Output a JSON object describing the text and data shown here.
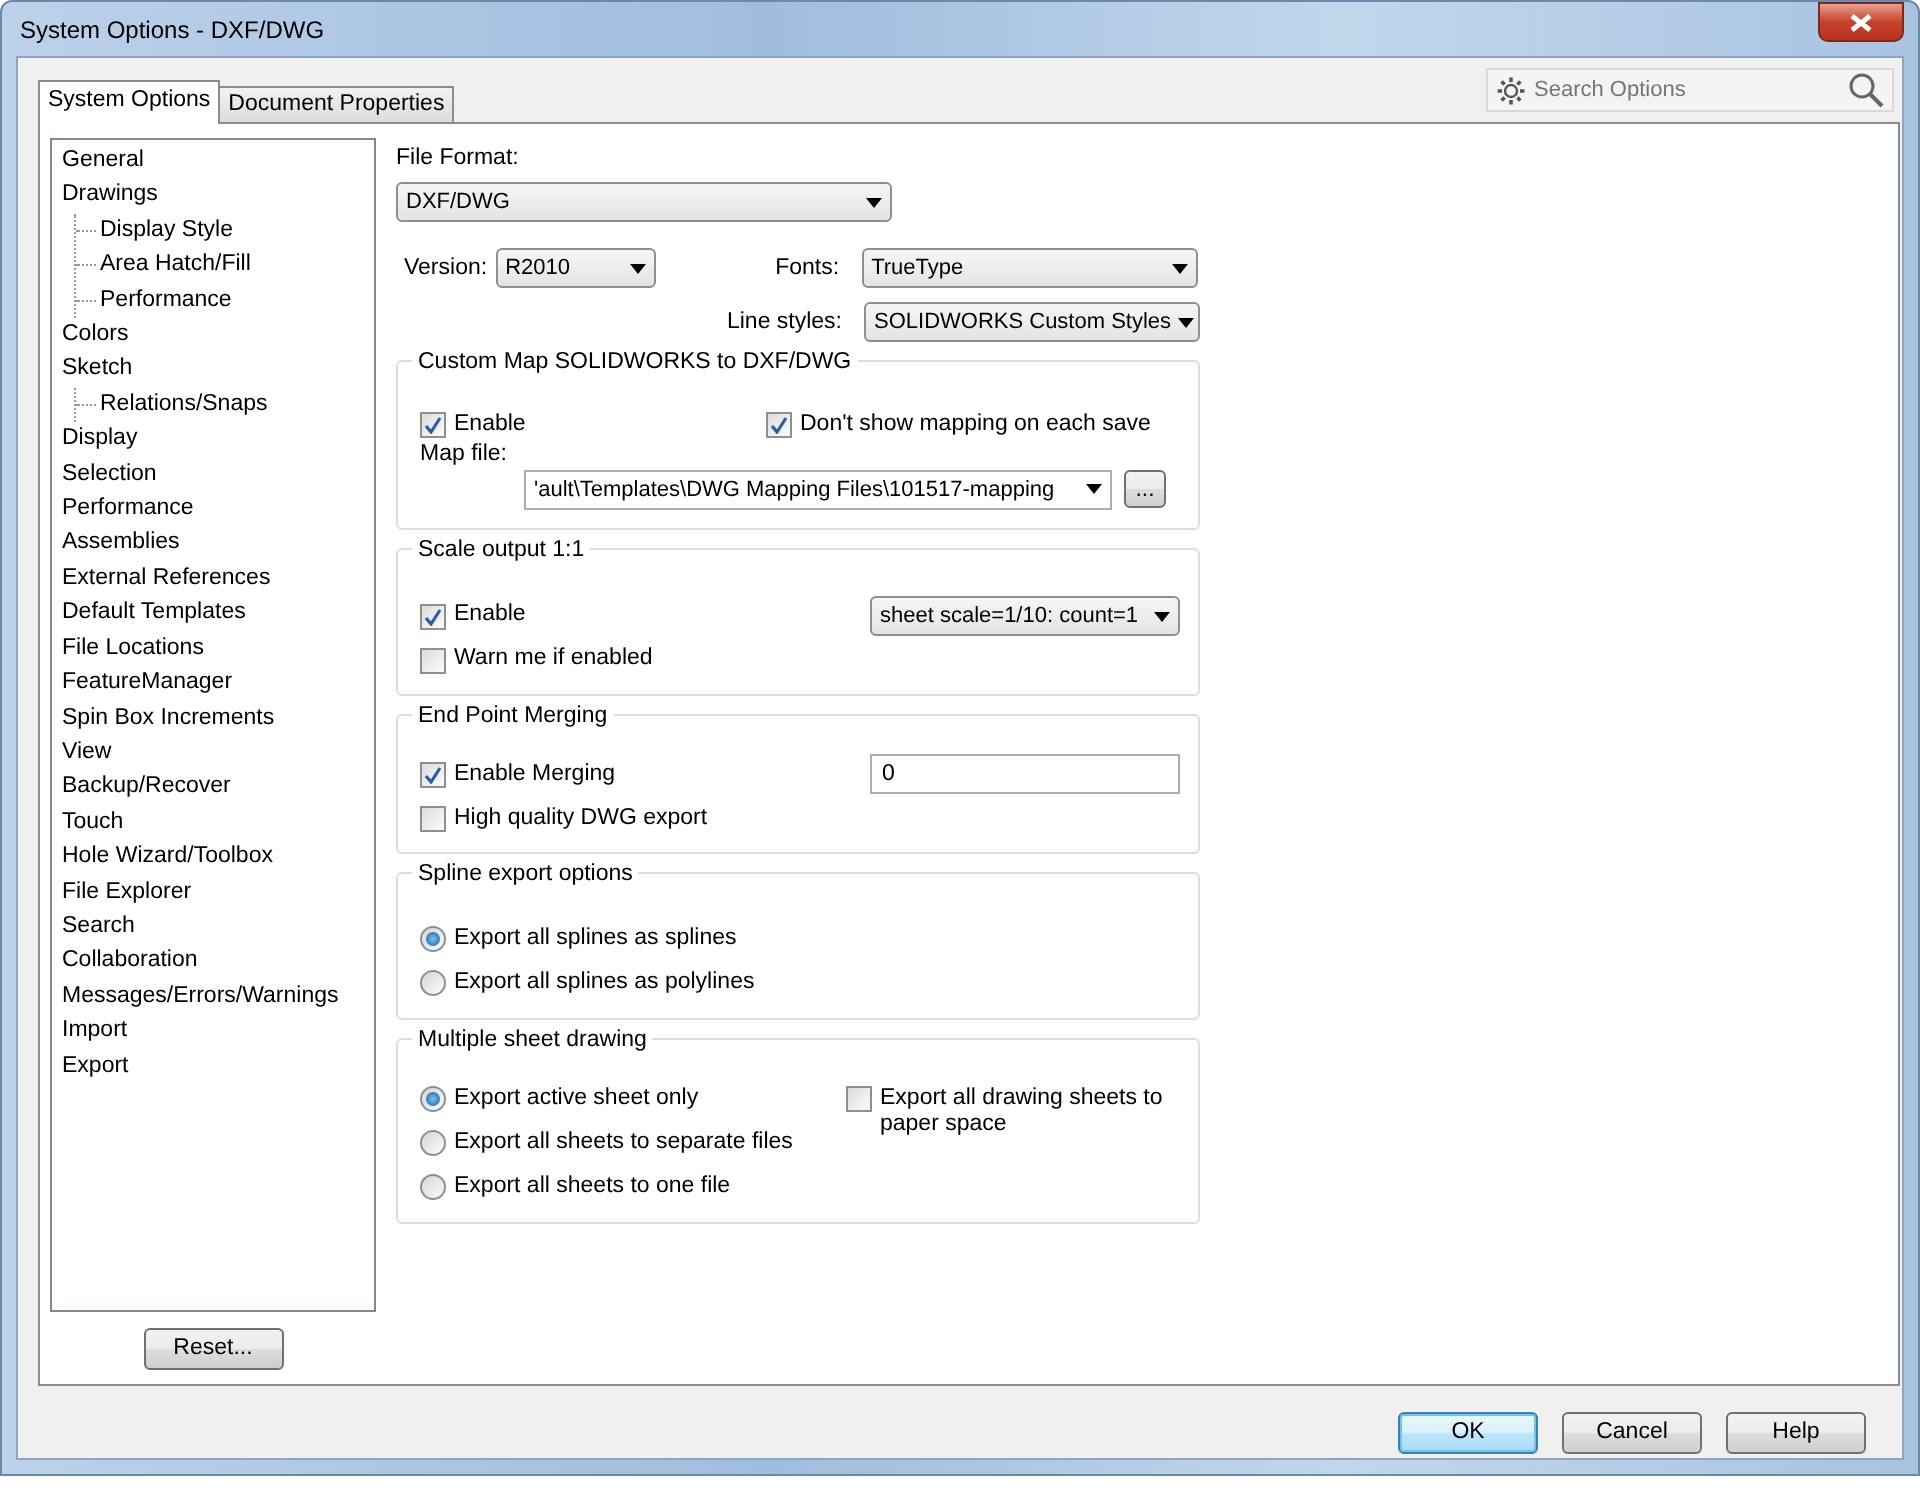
{
  "window": {
    "title": "System Options - DXF/DWG"
  },
  "tabs": [
    {
      "label": "System Options",
      "selected": true
    },
    {
      "label": "Document Properties",
      "selected": false
    }
  ],
  "search": {
    "placeholder": "Search Options"
  },
  "sidebar": {
    "items": [
      {
        "label": "General"
      },
      {
        "label": "Drawings",
        "children": [
          {
            "label": "Display Style"
          },
          {
            "label": "Area Hatch/Fill"
          },
          {
            "label": "Performance"
          }
        ]
      },
      {
        "label": "Colors"
      },
      {
        "label": "Sketch",
        "children": [
          {
            "label": "Relations/Snaps"
          }
        ]
      },
      {
        "label": "Display"
      },
      {
        "label": "Selection"
      },
      {
        "label": "Performance"
      },
      {
        "label": "Assemblies"
      },
      {
        "label": "External References"
      },
      {
        "label": "Default Templates"
      },
      {
        "label": "File Locations"
      },
      {
        "label": "FeatureManager"
      },
      {
        "label": "Spin Box Increments"
      },
      {
        "label": "View"
      },
      {
        "label": "Backup/Recover"
      },
      {
        "label": "Touch"
      },
      {
        "label": "Hole Wizard/Toolbox"
      },
      {
        "label": "File Explorer"
      },
      {
        "label": "Search"
      },
      {
        "label": "Collaboration"
      },
      {
        "label": "Messages/Errors/Warnings"
      },
      {
        "label": "Import"
      },
      {
        "label": "Export"
      }
    ],
    "reset_button": "Reset..."
  },
  "file_format": {
    "label": "File Format:",
    "value": "DXF/DWG"
  },
  "version": {
    "label": "Version:",
    "value": "R2010"
  },
  "fonts": {
    "label": "Fonts:",
    "value": "TrueType"
  },
  "line_styles": {
    "label": "Line styles:",
    "value": "SOLIDWORKS Custom Styles"
  },
  "groups": [
    {
      "kind": "map",
      "title": "Custom Map SOLIDWORKS to DXF/DWG",
      "enable": {
        "label": "Enable",
        "checked": true
      },
      "dont_show": {
        "label": "Don't show mapping on each save",
        "checked": true
      },
      "map_file_label": "Map file:",
      "map_file_value": "'ault\\Templates\\DWG Mapping Files\\101517-mapping",
      "browse_button": "..."
    },
    {
      "kind": "scale",
      "title": "Scale output 1:1",
      "enable": {
        "label": "Enable",
        "checked": true
      },
      "warn": {
        "label": "Warn me if enabled",
        "checked": false
      },
      "scale_value": "sheet scale=1/10: count=1"
    },
    {
      "kind": "merge",
      "title": "End Point Merging",
      "enable": {
        "label": "Enable Merging",
        "checked": true
      },
      "high_quality": {
        "label": "High quality DWG export",
        "checked": false
      },
      "tolerance": "0"
    },
    {
      "kind": "radios",
      "title": "Spline export options",
      "options": [
        {
          "label": "Export all splines as splines",
          "selected": true
        },
        {
          "label": "Export all splines as polylines",
          "selected": false
        }
      ]
    },
    {
      "kind": "sheets",
      "title": "Multiple sheet drawing",
      "options": [
        {
          "label": "Export active sheet only",
          "selected": true
        },
        {
          "label": "Export all sheets to separate files",
          "selected": false
        },
        {
          "label": "Export all sheets to one file",
          "selected": false
        }
      ],
      "paper_space": {
        "label": "Export all drawing sheets to paper space",
        "checked": false
      }
    }
  ],
  "buttons": [
    {
      "label": "OK",
      "focused": true
    },
    {
      "label": "Cancel",
      "focused": false
    },
    {
      "label": "Help",
      "focused": false
    }
  ]
}
